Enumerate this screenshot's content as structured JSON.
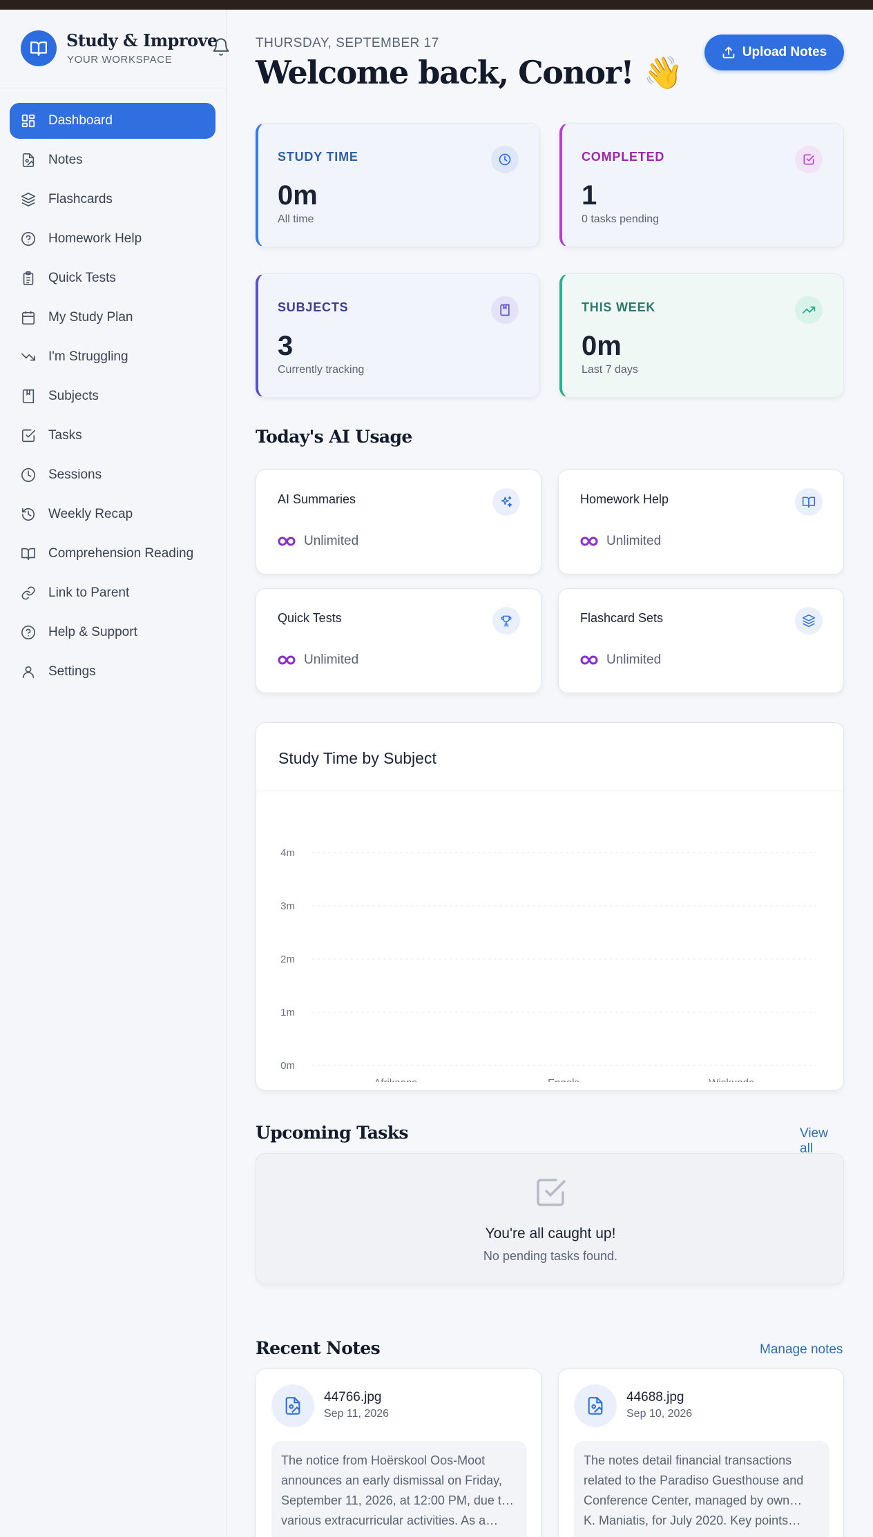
{
  "brand": {
    "title": "Study & Improve",
    "subtitle": "YOUR WORKSPACE"
  },
  "sidebar": {
    "items": [
      {
        "label": "Dashboard",
        "icon": "dashboard-icon",
        "active": true
      },
      {
        "label": "Notes",
        "icon": "note-file-icon"
      },
      {
        "label": "Flashcards",
        "icon": "layers-icon"
      },
      {
        "label": "Homework Help",
        "icon": "help-circle-icon"
      },
      {
        "label": "Quick Tests",
        "icon": "clipboard-icon"
      },
      {
        "label": "My Study Plan",
        "icon": "calendar-icon"
      },
      {
        "label": "I'm Struggling",
        "icon": "trending-down-icon"
      },
      {
        "label": "Subjects",
        "icon": "book-bookmark-icon"
      },
      {
        "label": "Tasks",
        "icon": "checkbox-icon"
      },
      {
        "label": "Sessions",
        "icon": "clock-icon"
      },
      {
        "label": "Weekly Recap",
        "icon": "history-icon"
      },
      {
        "label": "Comprehension Reading",
        "icon": "open-book-icon"
      },
      {
        "label": "Link to Parent",
        "icon": "link-icon"
      },
      {
        "label": "Help & Support",
        "icon": "help-circle-icon"
      },
      {
        "label": "Settings",
        "icon": "user-icon"
      }
    ]
  },
  "header": {
    "date": "THURSDAY, SEPTEMBER 17",
    "welcome": "Welcome back, Conor! 👋",
    "upload_label": "Upload Notes"
  },
  "stats": [
    {
      "label": "STUDY TIME",
      "value": "0m",
      "sub": "All time",
      "icon": "clock-icon",
      "color": "#2f5fa8",
      "accent": "#3b7be6"
    },
    {
      "label": "COMPLETED",
      "value": "1",
      "sub": "0 tasks pending",
      "icon": "check-square-icon",
      "color": "#9b2aa8",
      "accent": "#b043d1"
    },
    {
      "label": "SUBJECTS",
      "value": "3",
      "sub": "Currently tracking",
      "icon": "book-bookmark-icon",
      "color": "#3d3d8f",
      "accent": "#5a52c8"
    },
    {
      "label": "THIS WEEK",
      "value": "0m",
      "sub": "Last 7 days",
      "icon": "trending-up-icon",
      "color": "#2b7a6a",
      "accent": "#2fae8f"
    }
  ],
  "usage": {
    "title": "Today's AI Usage",
    "items": [
      {
        "label": "AI Summaries",
        "value": "Unlimited",
        "icon": "sparkles-icon"
      },
      {
        "label": "Homework Help",
        "value": "Unlimited",
        "icon": "open-book-icon"
      },
      {
        "label": "Quick Tests",
        "value": "Unlimited",
        "icon": "trophy-icon"
      },
      {
        "label": "Flashcard Sets",
        "value": "Unlimited",
        "icon": "layers-icon"
      }
    ]
  },
  "chart_data": {
    "type": "bar",
    "title": "Study Time by Subject",
    "categories": [
      "Afrikaans",
      "Engels",
      "Wiskunde"
    ],
    "values": [
      0,
      0,
      0
    ],
    "yticks": [
      "0m",
      "1m",
      "2m",
      "3m",
      "4m"
    ],
    "ylim": [
      0,
      4
    ],
    "grid": true
  },
  "tasks": {
    "title": "Upcoming Tasks",
    "link": "View all",
    "empty_title": "You're all caught up!",
    "empty_sub": "No pending tasks found."
  },
  "notes": {
    "title": "Recent Notes",
    "link": "Manage notes",
    "items": [
      {
        "name": "44766.jpg",
        "date": "Sep 11, 2026",
        "preview": [
          "The notice from Hoërskool Oos-Moot",
          "announces an early dismissal on Friday,",
          "September 11, 2026, at 12:00 PM, due t…",
          "various extracurricular activities. As a…"
        ]
      },
      {
        "name": "44688.jpg",
        "date": "Sep 10, 2026",
        "preview": [
          "The notes detail financial transactions",
          "related to the Paradiso Guesthouse and",
          "Conference Center, managed by own…",
          "K. Maniatis, for July 2020. Key points…"
        ]
      }
    ]
  }
}
